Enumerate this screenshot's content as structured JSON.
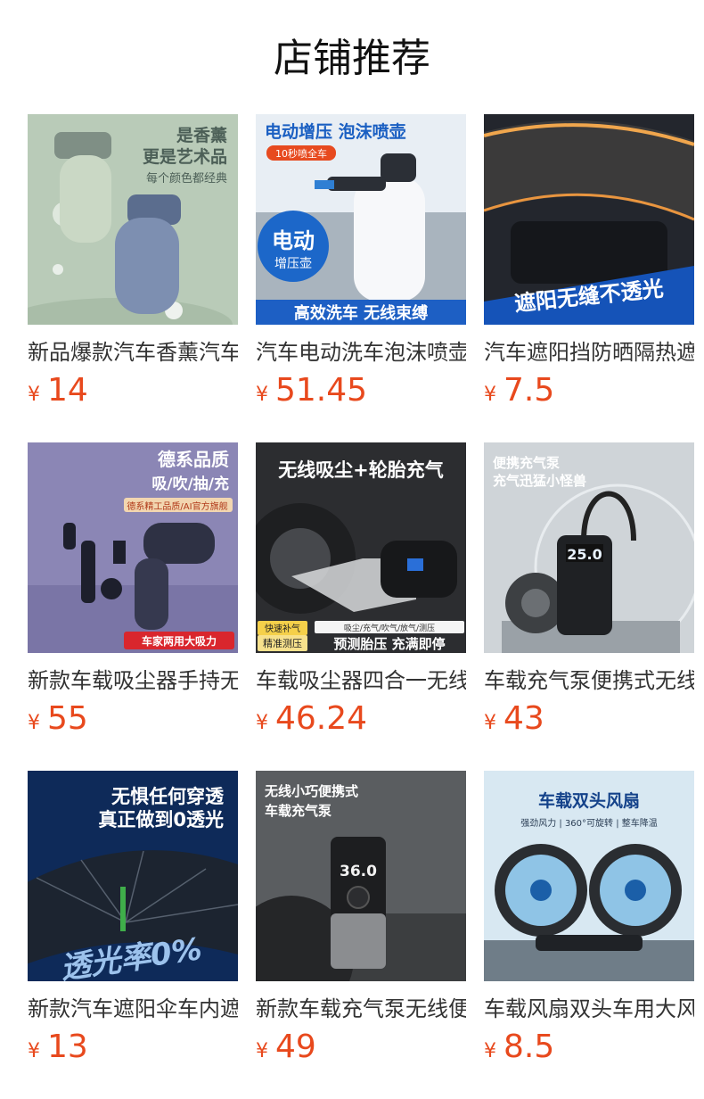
{
  "page_title": "店铺推荐",
  "currency": "¥",
  "products": [
    {
      "name": "新品爆款汽车香薰汽车香水车载香薰",
      "price": "14",
      "image_text": [
        "是香薰",
        "更是艺术品",
        "每个颜色都经典"
      ]
    },
    {
      "name": "汽车电动洗车泡沫喷壶高压喷雾器",
      "price": "51.45",
      "image_text": [
        "电动增压 泡沫喷壶",
        "10秒喷全车",
        "电动",
        "增压壶",
        "高效洗车 无线束缚"
      ]
    },
    {
      "name": "汽车遮阳挡防晒隔热遮阳帘前挡",
      "price": "7.5",
      "image_text": [
        "遮阳无缝不透光"
      ]
    },
    {
      "name": "新款车载吸尘器手持无线大吸力",
      "price": "55",
      "image_text": [
        "德系品质",
        "吸/吹/抽/充",
        "德系精工品质/AI官方旗舰",
        "车家两用大吸力"
      ]
    },
    {
      "name": "车载吸尘器四合一无线充气泵",
      "price": "46.24",
      "image_text": [
        "无线吸尘+轮胎充气",
        "快速补气",
        "精准测压",
        "吸尘/充气/吹气/放气/测压",
        "预测胎压 充满即停"
      ]
    },
    {
      "name": "车载充气泵便携式无线电动打气泵",
      "price": "43",
      "image_text": [
        "便携充气泵",
        "充气迅猛小怪兽",
        "25.0"
      ]
    },
    {
      "name": "新款汽车遮阳伞车内遮阳挡防晒",
      "price": "13",
      "image_text": [
        "无惧任何穿透",
        "真正做到0透光",
        "透光率0%"
      ]
    },
    {
      "name": "新款车载充气泵无线便携式打气泵",
      "price": "49",
      "image_text": [
        "无线小巧便携式",
        "车载充气泵",
        "36.0"
      ]
    },
    {
      "name": "车载风扇双头车用大风力电风扇",
      "price": "8.5",
      "image_text": [
        "车载双头风扇",
        "强劲风力 | 360°可旋转 | 整车降温"
      ]
    }
  ]
}
